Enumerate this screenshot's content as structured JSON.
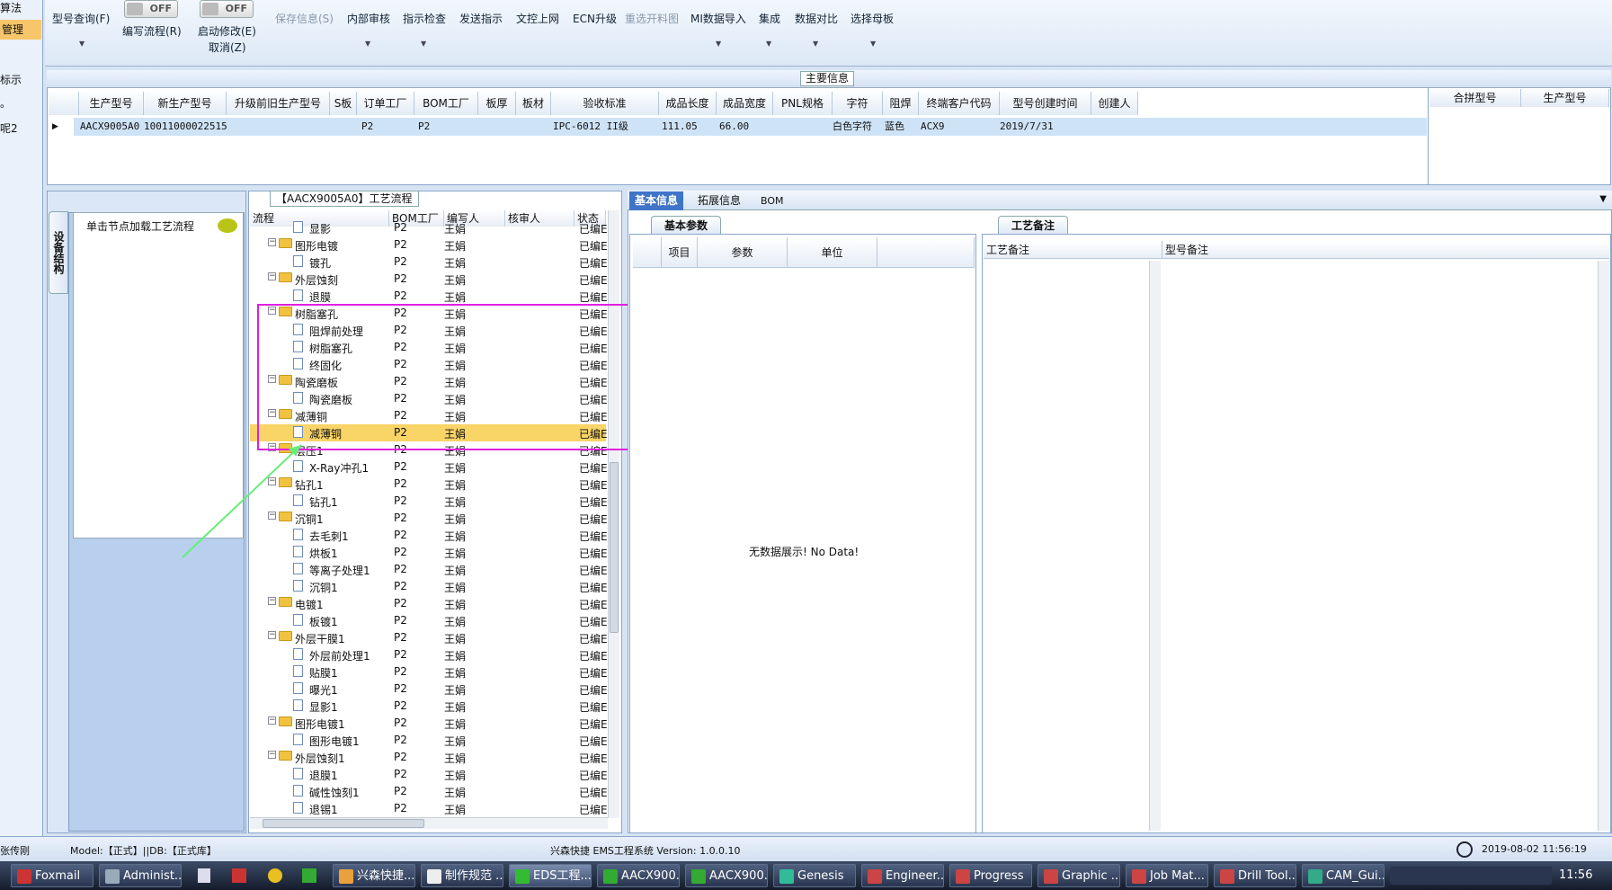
{
  "left_nav": {
    "item1": "算法",
    "item2": "管理",
    "item3": "标示",
    "item4": "。",
    "item5": "呢2"
  },
  "toolbar": {
    "model_query": "型号查询(F)",
    "edit_flow_toggle": "OFF",
    "edit_flow": "编写流程(R)",
    "start_modify_toggle": "OFF",
    "start_modify": "启动修改(E)",
    "cancel": "取消(Z)",
    "save_info": "保存信息(S)",
    "internal_review": "内部审核",
    "instruction_check": "指示检查",
    "send_instruction": "发送指示",
    "doc_upload": "文控上网",
    "ecn_upgrade": "ECN升级",
    "redraw": "重选开料图",
    "mi_import": "MI数据导入",
    "integrate": "集成",
    "data_compare": "数据对比",
    "select_motherboard": "选择母板"
  },
  "main_info": {
    "title": "主要信息",
    "columns": [
      "生产型号",
      "新生产型号",
      "升级前旧生产型号",
      "S板",
      "订单工厂",
      "BOM工厂",
      "板厚",
      "板材",
      "验收标准",
      "成品长度",
      "成品宽度",
      "PNL规格",
      "字符",
      "阻焊",
      "终端客户代码",
      "型号创建时间",
      "创建人"
    ],
    "row": {
      "prod_no": "AACX9005A0",
      "new_no": "10011000022515",
      "order_factory": "P2",
      "bom_factory": "P2",
      "standard": "IPC-6012 II级",
      "length": "111.05",
      "width": "66.00",
      "char": "白色字符",
      "mask": "蓝色",
      "customer": "ACX9",
      "created": "2019/7/31"
    },
    "side_columns": [
      "合拼型号",
      "生产型号"
    ]
  },
  "side": {
    "tab": "设备结构",
    "load_hint": "单击节点加载工艺流程"
  },
  "tree": {
    "title": "【AACX9005A0】工艺流程",
    "columns": [
      "流程",
      "BOM工厂",
      "编写人",
      "核审人",
      "状态"
    ],
    "rows": [
      {
        "name": "显影",
        "f": "P2",
        "a": "王娟",
        "s": "已编E",
        "type": "doc"
      },
      {
        "name": "图形电镀",
        "f": "P2",
        "a": "王娟",
        "s": "已编E",
        "type": "folder"
      },
      {
        "name": "镀孔",
        "f": "P2",
        "a": "王娟",
        "s": "已编E",
        "type": "doc"
      },
      {
        "name": "外层蚀刻",
        "f": "P2",
        "a": "王娟",
        "s": "已编E",
        "type": "folder"
      },
      {
        "name": "退膜",
        "f": "P2",
        "a": "王娟",
        "s": "已编E",
        "type": "doc"
      },
      {
        "name": "树脂塞孔",
        "f": "P2",
        "a": "王娟",
        "s": "已编E",
        "type": "folder"
      },
      {
        "name": "阻焊前处理",
        "f": "P2",
        "a": "王娟",
        "s": "已编E",
        "type": "doc"
      },
      {
        "name": "树脂塞孔",
        "f": "P2",
        "a": "王娟",
        "s": "已编E",
        "type": "doc"
      },
      {
        "name": "终固化",
        "f": "P2",
        "a": "王娟",
        "s": "已编E",
        "type": "doc"
      },
      {
        "name": "陶瓷磨板",
        "f": "P2",
        "a": "王娟",
        "s": "已编E",
        "type": "folder"
      },
      {
        "name": "陶瓷磨板",
        "f": "P2",
        "a": "王娟",
        "s": "已编E",
        "type": "doc"
      },
      {
        "name": "减薄铜",
        "f": "P2",
        "a": "王娟",
        "s": "已编E",
        "type": "folder"
      },
      {
        "name": "减薄铜",
        "f": "P2",
        "a": "王娟",
        "s": "已编E",
        "type": "doc",
        "selected": true
      },
      {
        "name": "层压1",
        "f": "P2",
        "a": "王娟",
        "s": "已编E",
        "type": "folder"
      },
      {
        "name": "X-Ray冲孔1",
        "f": "P2",
        "a": "王娟",
        "s": "已编E",
        "type": "doc"
      },
      {
        "name": "钻孔1",
        "f": "P2",
        "a": "王娟",
        "s": "已编E",
        "type": "folder"
      },
      {
        "name": "钻孔1",
        "f": "P2",
        "a": "王娟",
        "s": "已编E",
        "type": "doc"
      },
      {
        "name": "沉铜1",
        "f": "P2",
        "a": "王娟",
        "s": "已编E",
        "type": "folder"
      },
      {
        "name": "去毛刺1",
        "f": "P2",
        "a": "王娟",
        "s": "已编E",
        "type": "doc"
      },
      {
        "name": "烘板1",
        "f": "P2",
        "a": "王娟",
        "s": "已编E",
        "type": "doc"
      },
      {
        "name": "等离子处理1",
        "f": "P2",
        "a": "王娟",
        "s": "已编E",
        "type": "doc"
      },
      {
        "name": "沉铜1",
        "f": "P2",
        "a": "王娟",
        "s": "已编E",
        "type": "doc"
      },
      {
        "name": "电镀1",
        "f": "P2",
        "a": "王娟",
        "s": "已编E",
        "type": "folder"
      },
      {
        "name": "板镀1",
        "f": "P2",
        "a": "王娟",
        "s": "已编E",
        "type": "doc"
      },
      {
        "name": "外层干膜1",
        "f": "P2",
        "a": "王娟",
        "s": "已编E",
        "type": "folder"
      },
      {
        "name": "外层前处理1",
        "f": "P2",
        "a": "王娟",
        "s": "已编E",
        "type": "doc"
      },
      {
        "name": "贴膜1",
        "f": "P2",
        "a": "王娟",
        "s": "已编E",
        "type": "doc"
      },
      {
        "name": "曝光1",
        "f": "P2",
        "a": "王娟",
        "s": "已编E",
        "type": "doc"
      },
      {
        "name": "显影1",
        "f": "P2",
        "a": "王娟",
        "s": "已编E",
        "type": "doc"
      },
      {
        "name": "图形电镀1",
        "f": "P2",
        "a": "王娟",
        "s": "已编E",
        "type": "folder"
      },
      {
        "name": "图形电镀1",
        "f": "P2",
        "a": "王娟",
        "s": "已编E",
        "type": "doc"
      },
      {
        "name": "外层蚀刻1",
        "f": "P2",
        "a": "王娟",
        "s": "已编E",
        "type": "folder"
      },
      {
        "name": "退膜1",
        "f": "P2",
        "a": "王娟",
        "s": "已编E",
        "type": "doc"
      },
      {
        "name": "碱性蚀刻1",
        "f": "P2",
        "a": "王娟",
        "s": "已编E",
        "type": "doc"
      },
      {
        "name": "退锡1",
        "f": "P2",
        "a": "王娟",
        "s": "已编E",
        "type": "doc"
      }
    ]
  },
  "right": {
    "tabs": [
      "基本信息",
      "拓展信息",
      "BOM"
    ],
    "basic_params_tab": "基本参数",
    "param_columns": [
      "项目",
      "参数",
      "单位"
    ],
    "no_data": "无数据展示! No Data!",
    "process_notes_tab": "工艺备注",
    "process_note_col": "工艺备注",
    "model_note_col": "型号备注"
  },
  "status": {
    "user": "张传刚",
    "model": "Model:【正式】||DB:【正式库】",
    "system": "兴森快捷 EMS工程系统 Version: 1.0.0.10",
    "datetime": "2019-08-02 11:56:19"
  },
  "taskbar": {
    "items": [
      "Foxmail",
      "Administ...",
      "兴森快捷...",
      "制作规范 ...",
      "EDS工程...",
      "AACX900...",
      "AACX900...",
      "Genesis",
      "Engineer...",
      "Progress",
      "Graphic ...",
      "Job Mat...",
      "Drill Tool...",
      "CAM_Gui..."
    ],
    "clock": "11:56"
  },
  "colors": {
    "highlight_box": "#e020e0",
    "arrow": "#66ee77",
    "selected_row": "#f9d466"
  }
}
